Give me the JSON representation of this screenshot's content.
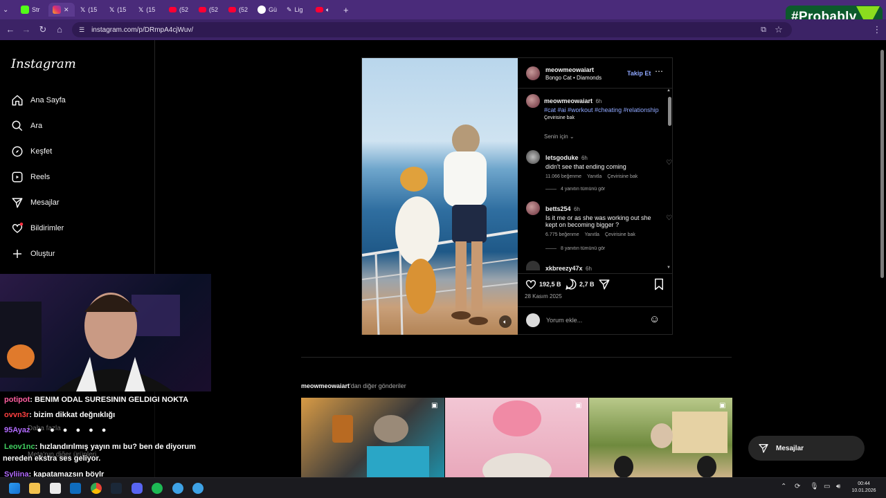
{
  "browser": {
    "tabs": [
      "Str",
      "",
      "(15",
      "(15",
      "(15",
      "(52",
      "(52",
      "(52",
      "Gü",
      "Lig",
      ""
    ],
    "new_tab": "+",
    "url": "instagram.com/p/DRmpA4cjWuv/"
  },
  "overlay_brand": "#Probably",
  "sidebar": {
    "logo": "Instagram",
    "items": [
      {
        "label": "Ana Sayfa",
        "icon": "home-icon"
      },
      {
        "label": "Ara",
        "icon": "search-icon"
      },
      {
        "label": "Keşfet",
        "icon": "compass-icon"
      },
      {
        "label": "Reels",
        "icon": "reels-icon"
      },
      {
        "label": "Mesajlar",
        "icon": "send-icon"
      },
      {
        "label": "Bildirimler",
        "icon": "heart-icon"
      },
      {
        "label": "Oluştur",
        "icon": "plus-icon"
      }
    ]
  },
  "post": {
    "author": "meowmeowaiart",
    "audio": "Bongo Cat • Diamonds",
    "follow": "Takip Et",
    "caption_time": "6h",
    "caption_tags": "#cat #ai #workout #cheating #relationship",
    "see_translation": "Çevirisine bak",
    "sort": "Senin için",
    "comments": [
      {
        "user": "letsgoduke",
        "time": "6h",
        "text": "didn't see that ending coming",
        "likes": "11.066 beğenme",
        "reply": "Yanıtla",
        "translate": "Çevirisine bak",
        "more": "4 yanıtın tümünü gör"
      },
      {
        "user": "betts254",
        "time": "6h",
        "text": "Is it me or as she was working out she kept on becoming bigger ?",
        "likes": "6.775 beğenme",
        "reply": "Yanıtla",
        "translate": "Çevirisine bak",
        "more": "8 yanıtın tümünü gör"
      },
      {
        "user": "xkbreezy47x",
        "time": "6h",
        "text": ""
      }
    ],
    "like_count": "192,5 B",
    "comment_count": "2,7 B",
    "date": "28 Kasım 2025",
    "comment_placeholder": "Yorum ekle..."
  },
  "more_posts": {
    "heading_user": "meowmeowaiart",
    "heading_rest": "'dan diğer gönderiler"
  },
  "messages_button": "Mesajlar",
  "stream": {
    "chat": [
      {
        "user": "potipot",
        "color": "#ff5fa0",
        "text": ": BENIM ODAL SURESININ GELDIGI NOKTA"
      },
      {
        "user": "ovvn3r",
        "color": "#ff4040",
        "text": ": bizim dikkat değnıklığı"
      },
      {
        "user": "95Ayaz",
        "color": "#b36bff",
        "text": ""
      },
      {
        "user": "Leov1nc",
        "color": "#40d060",
        "text": ": hızlandırılmış yayın mı bu? ben de diyorum"
      },
      {
        "user": "",
        "color": "#ffffff",
        "text": "nereden ekstra ses geliyor."
      },
      {
        "user": "Syliina",
        "color": "#b36bff",
        "text": ": kapatamazsın böylr"
      }
    ],
    "underlay": [
      "Daha fazla",
      "Meta'nın diğer ürünleri"
    ]
  },
  "taskbar": {
    "time": "00:44",
    "date": "10.01.2026"
  }
}
